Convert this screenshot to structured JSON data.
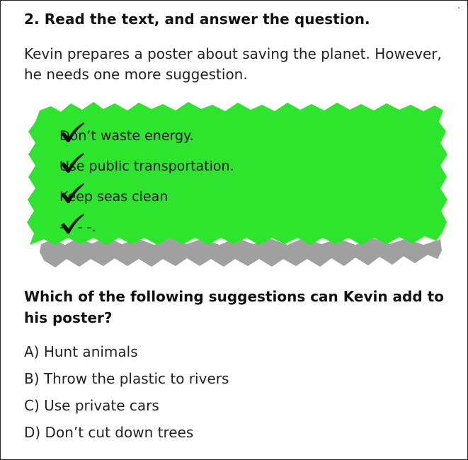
{
  "question": {
    "title": "2. Read the text, and answer the question.",
    "intro": "Kevin prepares a poster about saving the planet. However, he needs one more suggestion.",
    "prompt": "Which of the following suggestions can Kevin add to his poster?"
  },
  "poster": {
    "background_color": "#2ee52e",
    "shadow_color": "#a0a0a0",
    "items": [
      {
        "icon": "checkmark-icon",
        "label": "Don’t waste energy."
      },
      {
        "icon": "checkmark-icon",
        "label": "Use public transportation."
      },
      {
        "icon": "checkmark-icon",
        "label": "Keep seas clean"
      },
      {
        "icon": "checkmark-icon",
        "label": "- - - -."
      }
    ]
  },
  "options": [
    {
      "label": "A) Hunt animals"
    },
    {
      "label": "B) Throw the plastic to rivers"
    },
    {
      "label": "C) Use private cars"
    },
    {
      "label": "D) Don’t cut down trees"
    }
  ]
}
